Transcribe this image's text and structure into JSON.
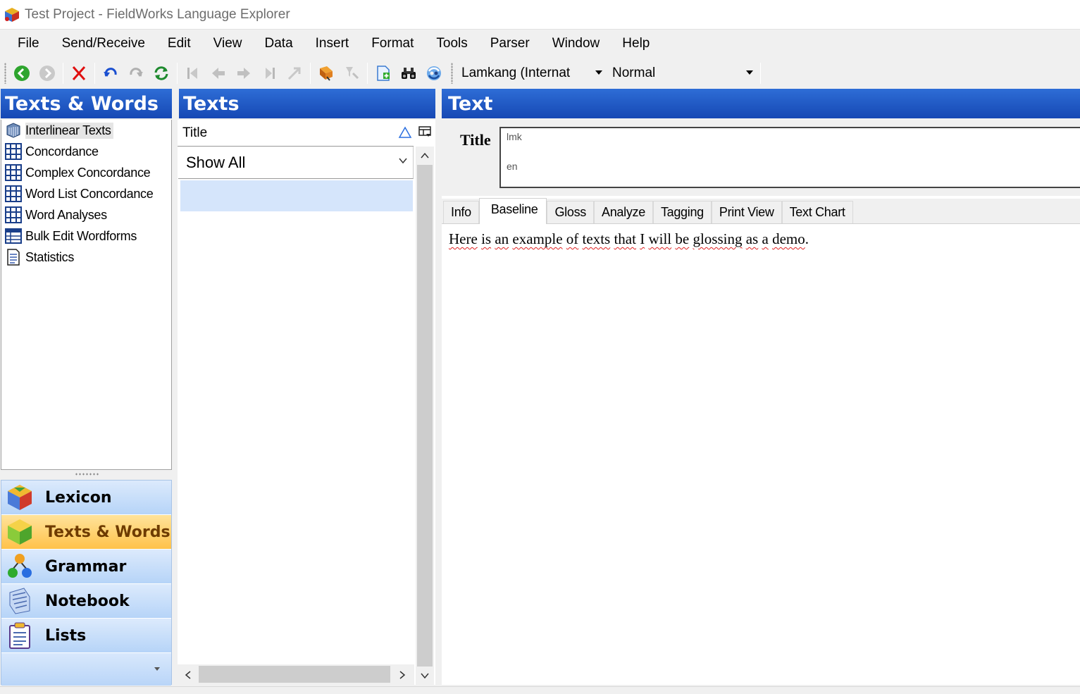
{
  "window": {
    "title": "Test Project - FieldWorks Language Explorer"
  },
  "menu": [
    "File",
    "Send/Receive",
    "Edit",
    "View",
    "Data",
    "Insert",
    "Format",
    "Tools",
    "Parser",
    "Window",
    "Help"
  ],
  "toolbar": {
    "writing_system": "Lamkang (Internat",
    "style": "Normal"
  },
  "left_pane": {
    "header": "Texts & Words",
    "items": [
      {
        "label": "Interlinear Texts",
        "icon": "interlinear-icon"
      },
      {
        "label": "Concordance",
        "icon": "concordance-icon"
      },
      {
        "label": "Complex Concordance",
        "icon": "complex-concordance-icon"
      },
      {
        "label": "Word List Concordance",
        "icon": "word-list-concordance-icon"
      },
      {
        "label": "Word Analyses",
        "icon": "word-analyses-icon"
      },
      {
        "label": "Bulk Edit Wordforms",
        "icon": "bulk-edit-icon"
      },
      {
        "label": "Statistics",
        "icon": "statistics-icon"
      }
    ]
  },
  "sidebar": {
    "areas": [
      {
        "label": "Lexicon",
        "icon": "lexicon-icon"
      },
      {
        "label": "Texts & Words",
        "icon": "texts-words-icon"
      },
      {
        "label": "Grammar",
        "icon": "grammar-icon"
      },
      {
        "label": "Notebook",
        "icon": "notebook-icon"
      },
      {
        "label": "Lists",
        "icon": "lists-icon"
      }
    ],
    "active": "Texts & Words"
  },
  "middle_pane": {
    "header": "Texts",
    "column_header": "Title",
    "filter": "Show All"
  },
  "right_pane": {
    "header": "Text",
    "title_label": "Title",
    "title_ws": [
      "lmk",
      "en"
    ],
    "tabs": [
      "Info",
      "Baseline",
      "Gloss",
      "Analyze",
      "Tagging",
      "Print View",
      "Text Chart"
    ],
    "active_tab": "Baseline",
    "baseline_words": [
      "Here",
      "is",
      "an",
      "example",
      "of",
      "texts",
      "that",
      "I",
      "will",
      "be",
      "glossing",
      "as",
      "a",
      "demo"
    ],
    "baseline_end": "."
  }
}
